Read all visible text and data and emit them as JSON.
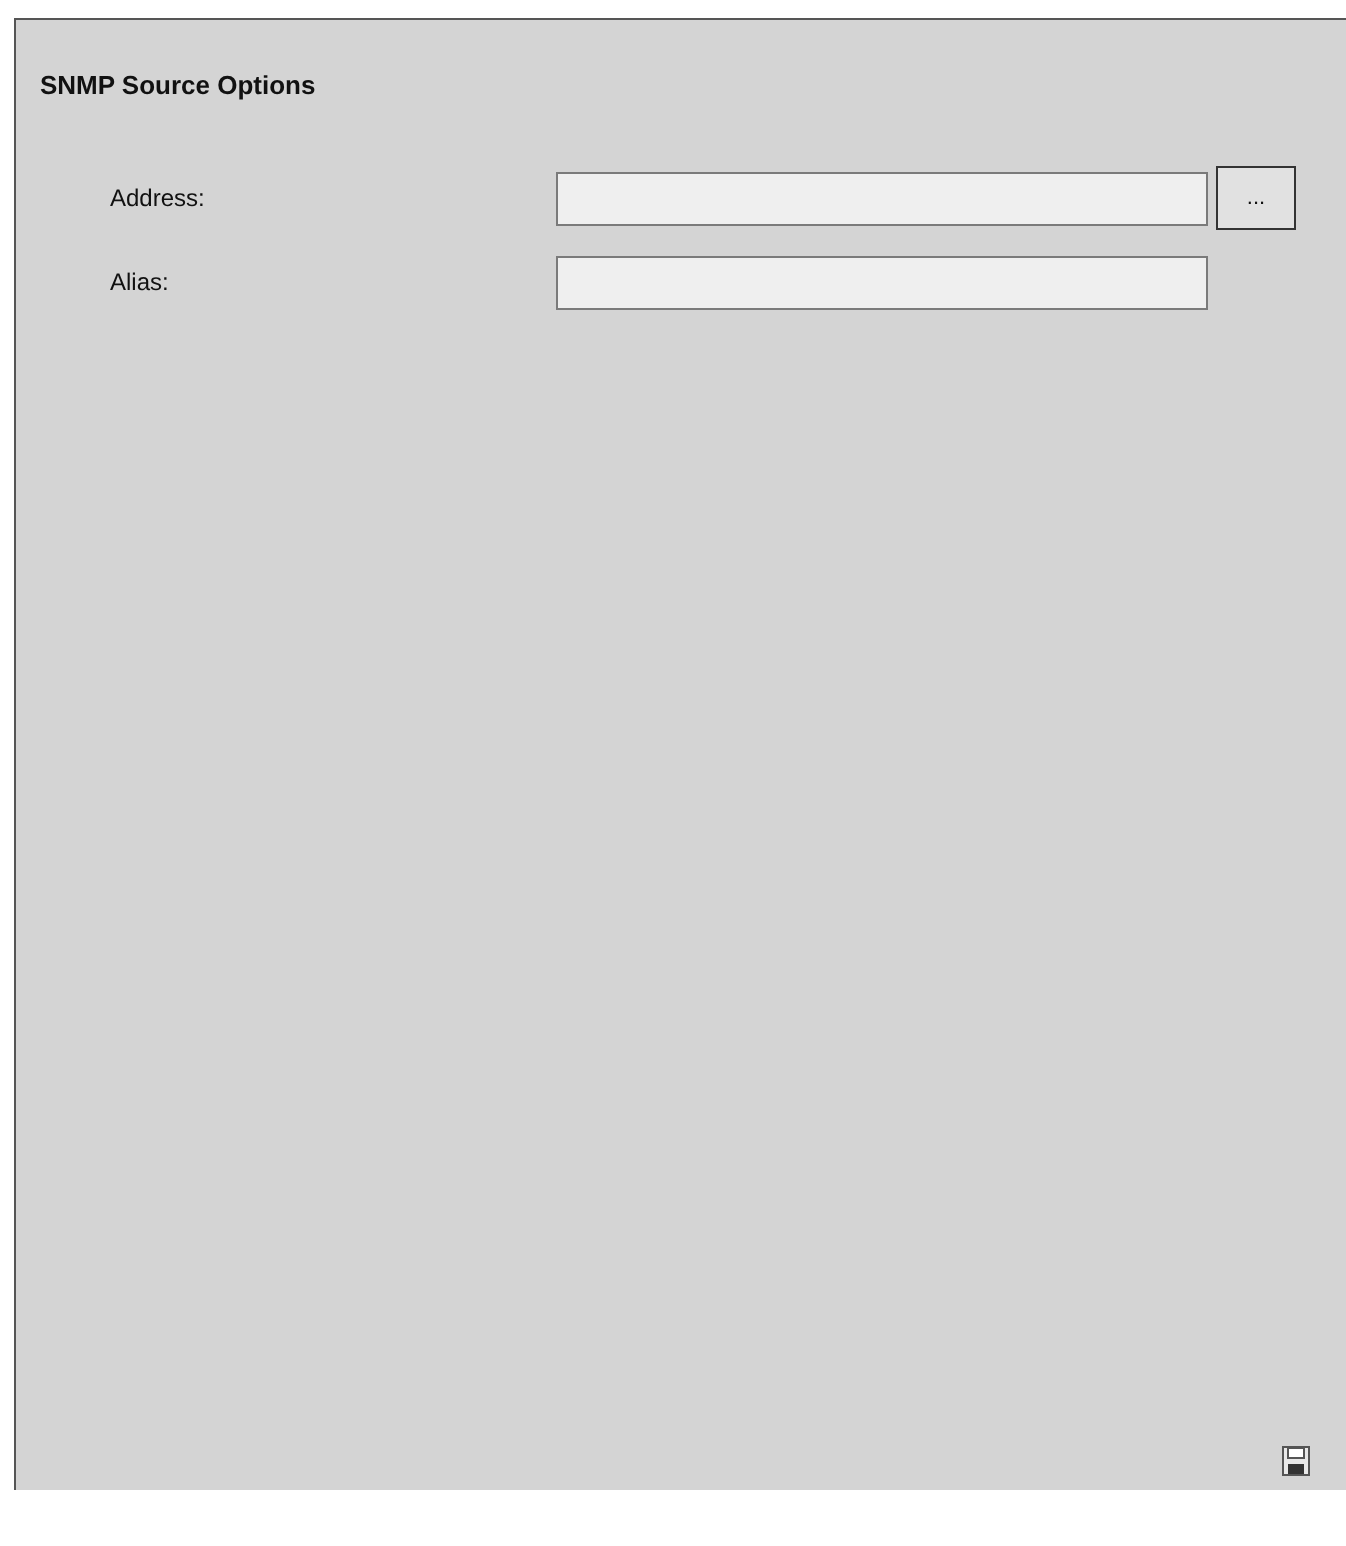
{
  "title": "SNMP Source Options",
  "fields": [
    {
      "label": "Address:",
      "browse_button": "..."
    },
    {
      "label": "Alias:"
    }
  ]
}
